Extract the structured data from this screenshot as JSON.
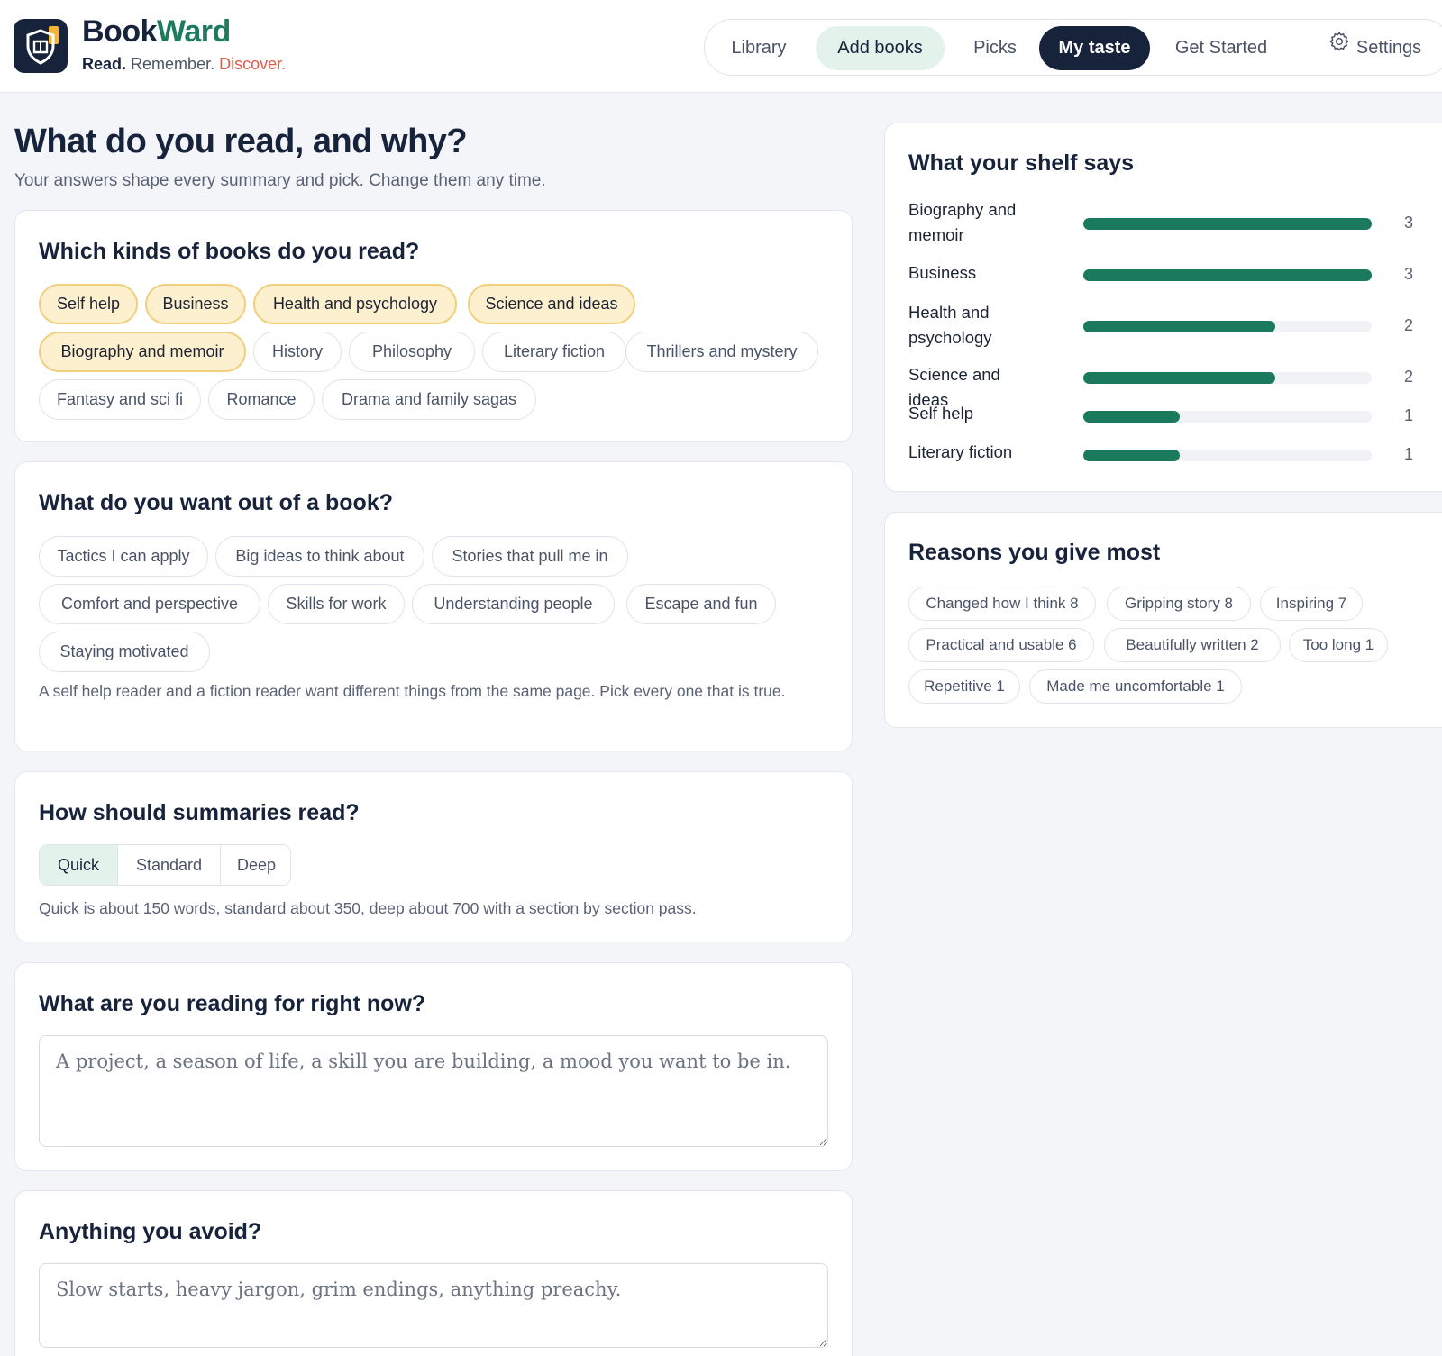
{
  "brand": {
    "name_part1": "Book",
    "name_part2": "Ward",
    "tagline_part1": "Read.",
    "tagline_part2": "Remember.",
    "tagline_part3": "Discover."
  },
  "nav": {
    "items": [
      {
        "label": "Library",
        "state": "normal"
      },
      {
        "label": "Add books",
        "state": "highlight"
      },
      {
        "label": "Picks",
        "state": "normal"
      },
      {
        "label": "My taste",
        "state": "active"
      },
      {
        "label": "Get Started",
        "state": "normal"
      },
      {
        "label": "Settings",
        "state": "normal",
        "icon": "gear-icon"
      }
    ]
  },
  "page": {
    "title": "What do you read, and why?",
    "subtitle": "Your answers shape every summary and pick. Change them any time."
  },
  "genres": {
    "title": "Which kinds of books do you read?",
    "chips": [
      {
        "label": "Self help",
        "selected": true
      },
      {
        "label": "Business",
        "selected": true
      },
      {
        "label": "Health and psychology",
        "selected": true
      },
      {
        "label": "Science and ideas",
        "selected": true
      },
      {
        "label": "Biography and memoir",
        "selected": true
      },
      {
        "label": "History",
        "selected": false
      },
      {
        "label": "Philosophy",
        "selected": false
      },
      {
        "label": "Literary fiction",
        "selected": false
      },
      {
        "label": "Thrillers and mystery",
        "selected": false
      },
      {
        "label": "Fantasy and sci fi",
        "selected": false
      },
      {
        "label": "Romance",
        "selected": false
      },
      {
        "label": "Drama and family sagas",
        "selected": false
      }
    ]
  },
  "wants": {
    "title": "What do you want out of a book?",
    "chips": [
      {
        "label": "Tactics I can apply",
        "selected": false
      },
      {
        "label": "Big ideas to think about",
        "selected": false
      },
      {
        "label": "Stories that pull me in",
        "selected": false
      },
      {
        "label": "Comfort and perspective",
        "selected": false
      },
      {
        "label": "Skills for work",
        "selected": false
      },
      {
        "label": "Understanding people",
        "selected": false
      },
      {
        "label": "Escape and fun",
        "selected": false
      },
      {
        "label": "Staying motivated",
        "selected": false
      }
    ],
    "helper": "A self help reader and a fiction reader want different things from the same page. Pick every one that is true."
  },
  "summaries": {
    "title": "How should summaries read?",
    "options": [
      {
        "label": "Quick",
        "selected": true
      },
      {
        "label": "Standard",
        "selected": false
      },
      {
        "label": "Deep",
        "selected": false
      }
    ],
    "helper": "Quick is about 150 words, standard about 350, deep about 700 with a section by section pass."
  },
  "reading_now": {
    "title": "What are you reading for right now?",
    "value": "",
    "placeholder": "A project, a season of life, a skill you are building, a mood you want to be in."
  },
  "avoid": {
    "title": "Anything you avoid?",
    "value": "",
    "placeholder": "Slow starts, heavy jargon, grim endings, anything preachy."
  },
  "shelf": {
    "title": "What your shelf says",
    "max": 3,
    "rows": [
      {
        "label": "Biography and memoir",
        "count": "3",
        "value": 3
      },
      {
        "label": "Business",
        "count": "3",
        "value": 3
      },
      {
        "label": "Health and psychology",
        "count": "2",
        "value": 2
      },
      {
        "label": "Science and ideas",
        "count": "2",
        "value": 2
      },
      {
        "label": "Self help",
        "count": "1",
        "value": 1
      },
      {
        "label": "Literary fiction",
        "count": "1",
        "value": 1
      }
    ],
    "bar_color": "#1a7a5b"
  },
  "reasons": {
    "title": "Reasons you give most",
    "chips": [
      "Changed how I think 8",
      "Gripping story 8",
      "Inspiring 7",
      "Practical and usable 6",
      "Beautifully written 2",
      "Too long 1",
      "Repetitive 1",
      "Made me uncomfortable 1"
    ]
  },
  "colors": {
    "brand_navy": "#17223b",
    "brand_green": "#1d7a5c",
    "accent_coral": "#e05b4a",
    "chip_selected_bg": "#fdf0cf",
    "chip_selected_border": "#f1cf7e",
    "soft_green": "#e3f3ec"
  }
}
